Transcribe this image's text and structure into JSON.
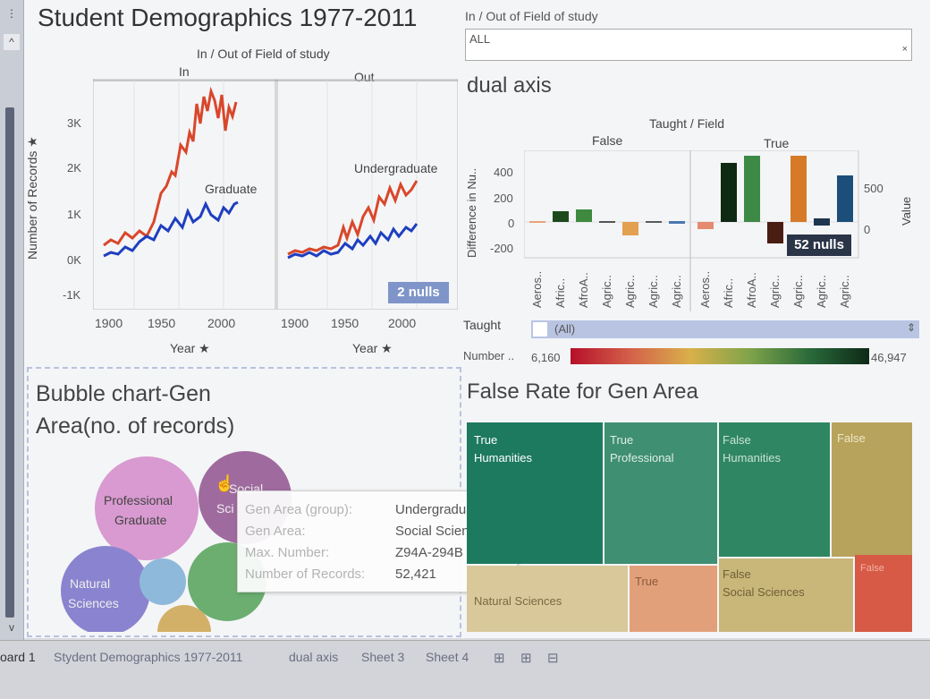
{
  "dashboard": {
    "title": "Student Demographics 1977-2011"
  },
  "filter": {
    "label": "In / Out of Field of study",
    "value": "ALL",
    "clear": "×"
  },
  "line_chart": {
    "header": "In / Out of Field of study",
    "panes": [
      "In",
      "Out"
    ],
    "y_axis_label": "Number of Records ★",
    "y_ticks": [
      "3K",
      "2K",
      "1K",
      "0K",
      "-1K"
    ],
    "x_ticks": [
      "1900",
      "1950",
      "2000"
    ],
    "x_axis_label": "Year ★",
    "series_labels": {
      "graduate": "Graduate",
      "undergraduate": "Undergraduate"
    },
    "nulls_badge": "2 nulls",
    "colors": {
      "graduate": "#d9472b",
      "undergraduate": "#1f3fbf"
    }
  },
  "dual_axis": {
    "title": "dual axis",
    "header": "Taught / Field",
    "groups": [
      "False",
      "True"
    ],
    "left_axis_label": "Difference in Nu..",
    "left_ticks": [
      "400",
      "200",
      "0",
      "-200"
    ],
    "right_axis_label": "Value",
    "right_ticks": [
      "500",
      "0"
    ],
    "categories": [
      "Aeros..",
      "Afric..",
      "AfroA..",
      "Agric..",
      "Agric..",
      "Agric..",
      "Agric..",
      "Aeros..",
      "Afric..",
      "AfroA..",
      "Agric..",
      "Agric..",
      "Agric..",
      "Agric.."
    ],
    "nulls_badge": "52 nulls"
  },
  "legend": {
    "taught_label": "Taught",
    "taught_value": "(All)",
    "number_label": "Number ..",
    "min": "6,160",
    "max": "46,947"
  },
  "bubble": {
    "title_line1": "Bubble chart-Gen",
    "title_line2": "Area(no. of records)",
    "labels": {
      "professional": "Professional",
      "professional_sub": "Graduate",
      "social": "Social",
      "social_sub": "Sci",
      "natural": "Natural",
      "natural_sub": "Sciences"
    }
  },
  "tooltip": {
    "rows": [
      {
        "key": "Gen Area (group):",
        "value": "Undergraduate"
      },
      {
        "key": "Gen Area:",
        "value": "Social Sciences"
      },
      {
        "key": "Max. Number:",
        "value": "Z94A-294B"
      },
      {
        "key": "Number of Records:",
        "value": "52,421"
      }
    ]
  },
  "treemap": {
    "title": "False Rate for Gen Area",
    "tiles": [
      {
        "line1": "True",
        "line2": "Humanities",
        "color": "#1d7a5f"
      },
      {
        "line1": "True",
        "line2": "Professional",
        "color": "#3f8f72"
      },
      {
        "line1": "False",
        "line2": "Humanities",
        "color": "#2f8663"
      },
      {
        "line1": "False",
        "line2": "",
        "color": "#b7a35c"
      },
      {
        "line1": "Natural Sciences",
        "line2": "",
        "color": "#d8c89a"
      },
      {
        "line1": "True",
        "line2": "",
        "color": "#e2a07a"
      },
      {
        "line1": "False",
        "line2": "Social Sciences",
        "color": "#c9b77a"
      },
      {
        "line1": "False",
        "line2": "",
        "color": "#d65a45"
      }
    ]
  },
  "tabs": [
    "oard 1",
    "Stydent Demographics 1977-2011",
    "dual axis",
    "Sheet 3",
    "Sheet 4"
  ],
  "leftbar": {
    "top_glyph": "⋮",
    "up_glyph": "^",
    "down_glyph": "v"
  }
}
